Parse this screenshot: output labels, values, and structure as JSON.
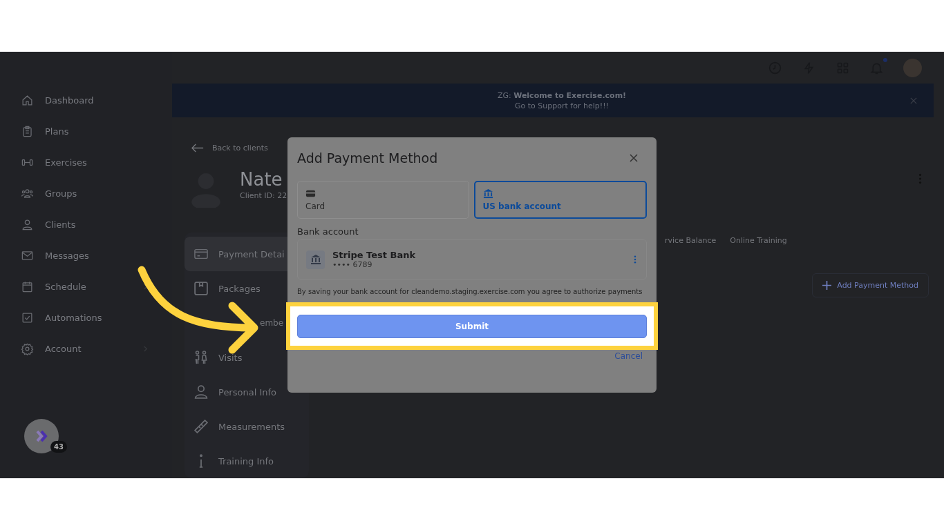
{
  "sidebar": {
    "items": [
      {
        "label": "Dashboard",
        "kind": "home",
        "expandable": false
      },
      {
        "label": "Plans",
        "kind": "clipboard",
        "expandable": false
      },
      {
        "label": "Exercises",
        "kind": "dumbbell",
        "expandable": false
      },
      {
        "label": "Groups",
        "kind": "group",
        "expandable": false
      },
      {
        "label": "Clients",
        "kind": "person",
        "expandable": false
      },
      {
        "label": "Messages",
        "kind": "mail",
        "expandable": false
      },
      {
        "label": "Schedule",
        "kind": "calendar",
        "expandable": true
      },
      {
        "label": "Automations",
        "kind": "checkbox",
        "expandable": false
      },
      {
        "label": "Account",
        "kind": "gear",
        "expandable": true
      }
    ],
    "launcher_badge": "43"
  },
  "topbar": {
    "notifications_unread": true
  },
  "banner": {
    "line_1": "ZG: **Welcome to Exercise.com!**",
    "line_2": "Go to Support for help!!!"
  },
  "back_link": "Back to clients",
  "client": {
    "name": "Nate",
    "id_label": "Client ID: 22"
  },
  "client_nav": [
    {
      "label": "Payment Detai",
      "kind": "card",
      "selected": true
    },
    {
      "label": "Packages",
      "kind": "box",
      "selected": false
    },
    {
      "label": "embe",
      "kind": "covered",
      "selected": false
    },
    {
      "label": "Visits",
      "kind": "visits",
      "selected": false
    },
    {
      "label": "Personal Info",
      "kind": "person",
      "selected": false
    },
    {
      "label": "Measurements",
      "kind": "ruler",
      "selected": false
    },
    {
      "label": "Training Info",
      "kind": "info",
      "selected": false
    }
  ],
  "client_tabs": [
    "rvice Balance",
    "Online Training"
  ],
  "add_payment_button": "Add Payment Method",
  "modal": {
    "title": "Add Payment Method",
    "methods": [
      {
        "label": "Card",
        "kind": "card",
        "selected": false
      },
      {
        "label": "US bank account",
        "kind": "bank",
        "selected": true
      }
    ],
    "section_label": "Bank account",
    "bank": {
      "name": "Stripe Test Bank",
      "number": "•••• 6789"
    },
    "disclaimer": "By saving your bank account for cleandemo.staging.exercise.com you agree to authorize payments",
    "submit": "Submit",
    "cancel": "Cancel"
  }
}
